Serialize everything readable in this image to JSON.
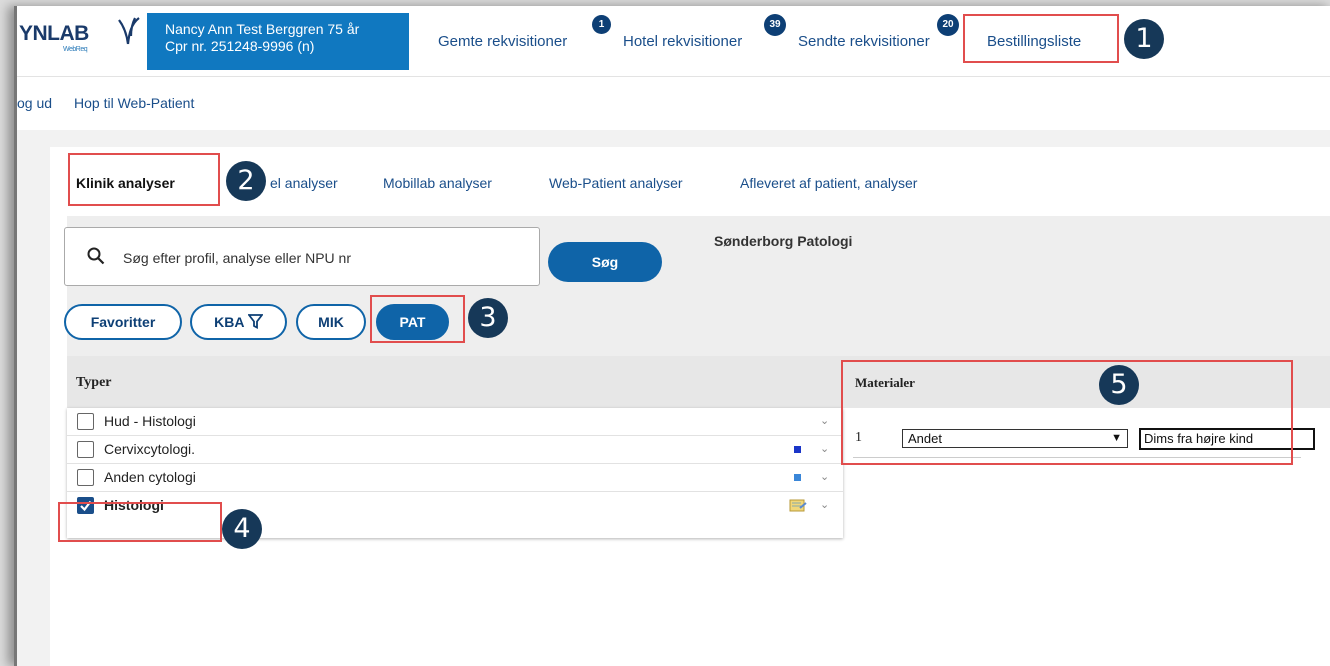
{
  "app": {
    "logo_main": "YNLAB",
    "logo_sub": "WebReq"
  },
  "patient": {
    "name_line": "Nancy Ann Test Berggren 75 år",
    "cpr_line": "Cpr nr. 251248-9996 (n)"
  },
  "nav": [
    {
      "label": "Gemte rekvisitioner",
      "badge": "1"
    },
    {
      "label": "Hotel rekvisitioner",
      "badge": "39"
    },
    {
      "label": "Sendte rekvisitioner",
      "badge": "20"
    },
    {
      "label": "Bestillingsliste"
    }
  ],
  "links": {
    "logout": "og ud",
    "web_patient": "Hop til Web-Patient"
  },
  "tabs": [
    "Klinik analyser",
    "el analyser",
    "Mobillab analyser",
    "Web-Patient analyser",
    "Afleveret af patient, analyser"
  ],
  "search": {
    "placeholder": "Søg efter profil, analyse eller NPU nr",
    "button": "Søg"
  },
  "lab_name": "Sønderborg Patologi",
  "filters": [
    "Favoritter",
    "KBA",
    "MIK",
    "PAT"
  ],
  "types": {
    "header": "Typer",
    "items": [
      {
        "label": "Hud - Histologi",
        "checked": false
      },
      {
        "label": "Cervixcytologi.",
        "checked": false
      },
      {
        "label": "Anden cytologi",
        "checked": false
      },
      {
        "label": "Histologi",
        "checked": true
      }
    ]
  },
  "materials": {
    "header": "Materialer",
    "rows": [
      {
        "number": "1",
        "material": "Andet",
        "description": "Dims fra højre kind"
      }
    ]
  },
  "callouts": [
    "1",
    "2",
    "3",
    "4",
    "5"
  ],
  "colors": {
    "brand_blue": "#1078c0",
    "dark_navy": "#163858",
    "highlight_red": "#e14d4d"
  }
}
